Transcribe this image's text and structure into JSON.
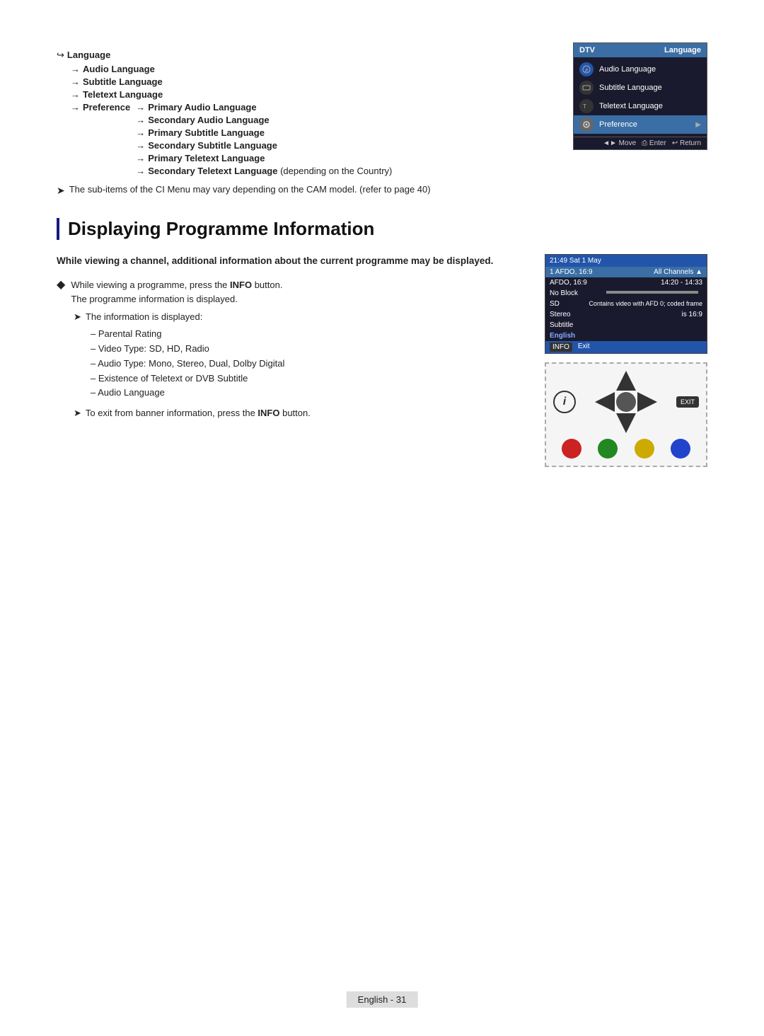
{
  "language_tree": {
    "root": "Language",
    "children": [
      "Audio Language",
      "Subtitle Language",
      "Teletext Language"
    ],
    "preference": "Preference",
    "preference_children": [
      "Primary Audio Language",
      "Secondary Audio Language",
      "Primary Subtitle Language",
      "Secondary Subtitle Language",
      "Primary Teletext Language"
    ],
    "last_item": "Secondary Teletext Language",
    "last_item_suffix": " (depending on the Country)"
  },
  "note1": "The sub-items of the CI Menu may vary depending on the CAM model. (refer to page 40)",
  "dtv_menu": {
    "header_left": "DTV",
    "header_right": "Language",
    "items": [
      {
        "icon": "globe",
        "label": "Audio Language",
        "arrow": false
      },
      {
        "icon": "subtitle",
        "label": "Subtitle Language",
        "arrow": false
      },
      {
        "icon": "teletext",
        "label": "Teletext Language",
        "arrow": false
      },
      {
        "icon": "gear",
        "label": "Preference",
        "arrow": true
      }
    ],
    "footer": "◄► Move  ⎙ Enter  ↩ Return"
  },
  "section_title": "Displaying Programme Information",
  "intro_bold": "While viewing a channel, additional information about the current programme may be displayed.",
  "bullet": {
    "text1": "While viewing a programme, press the ",
    "bold": "INFO",
    "text2": " button.",
    "subtext": "The programme information is displayed."
  },
  "note2_prefix": "The information is displayed:",
  "list_items": [
    "Parental Rating",
    "Video Type: SD, HD, Radio",
    "Audio Type: Mono, Stereo, Dual, Dolby Digital",
    "Existence of Teletext or DVB Subtitle",
    "Audio Language"
  ],
  "note3_prefix": "To exit from banner information, press the ",
  "note3_bold": "INFO",
  "note3_suffix": " button.",
  "tv_info": {
    "header_time": "21:49 Sat 1 May",
    "row1_left": "1 AFDO, 16:9",
    "row1_right": "All Channels ▲",
    "row2_left": "AFDO, 16:9",
    "row2_right": "14:20 - 14:33",
    "row3": "No Block",
    "row4_left": "SD",
    "row4_right": "Contains video with AFD 0; coded frame",
    "row5_left": "Stereo",
    "row5_right": "is 16:9",
    "row6": "Subtitle",
    "row7": "English",
    "footer_left": "INFO",
    "footer_right": "Exit"
  },
  "footer": {
    "label": "English - 31"
  }
}
